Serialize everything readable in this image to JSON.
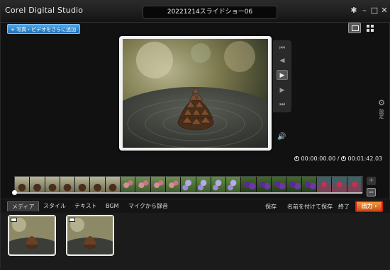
{
  "app": {
    "title": "Corel Digital Studio",
    "document_title": "20221214スライドショー06"
  },
  "window_controls": [
    "✱",
    "–",
    "□",
    "✕"
  ],
  "toolbar": {
    "add_media_label": "+ 写真・ビデオをさらに追加"
  },
  "player": {
    "controls": [
      "go-to-start",
      "previous",
      "play",
      "next",
      "go-to-end"
    ],
    "timecode_current": "00:00:00.00",
    "timecode_separator": "/",
    "timecode_total": "00:01:42.03"
  },
  "settings": {
    "label": "設定"
  },
  "timeline": {
    "thumbnails": [
      "pinecone",
      "pinecone",
      "pinecone",
      "pinecone",
      "pinecone",
      "pinecone",
      "pinecone",
      "pink-flower",
      "pink-flower",
      "pink-flower",
      "pink-flower",
      "lilac-flower",
      "lilac-flower",
      "lilac-flower",
      "lilac-flower",
      "purple-flower",
      "purple-flower",
      "purple-flower",
      "purple-flower",
      "purple-flower",
      "red-flower",
      "red-flower",
      "red-flower"
    ],
    "progress": 0
  },
  "tabs": {
    "media": "メディア",
    "style": "スタイル",
    "text": "テキスト",
    "bgm": "BGM",
    "record": "マイクから録音"
  },
  "actions": {
    "save": "保存",
    "save_as": "名前を付けて保存",
    "exit": "終了",
    "output": "出力 ›"
  },
  "media_items": [
    {
      "type": "video",
      "subject": "pinecone"
    },
    {
      "type": "video",
      "subject": "pinecone"
    }
  ],
  "colors": {
    "accent": "#1f6fb8",
    "output": "#e0762a",
    "highlight_border": "#e01414"
  }
}
